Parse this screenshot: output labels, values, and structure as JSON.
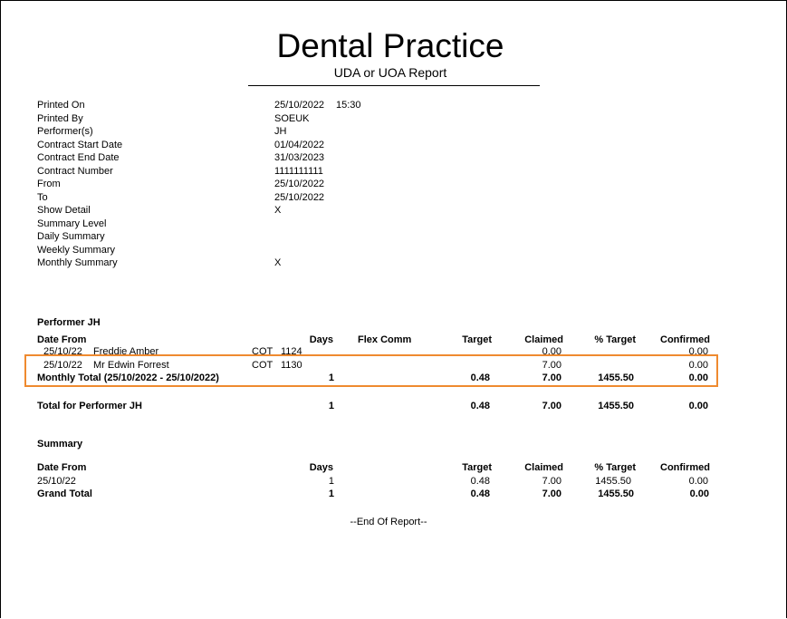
{
  "report": {
    "title": "Dental Practice",
    "subtitle": "UDA or UOA Report"
  },
  "info": [
    {
      "label": "Printed On",
      "value": "25/10/2022",
      "extra": "15:30"
    },
    {
      "label": "Printed By",
      "value": "SOEUK"
    },
    {
      "label": "Performer(s)",
      "value": "JH"
    },
    {
      "label": "Contract Start Date",
      "value": "01/04/2022"
    },
    {
      "label": "Contract End Date",
      "value": "31/03/2023"
    },
    {
      "label": "Contract Number",
      "value": "1111111111"
    },
    {
      "label": "From",
      "value": "25/10/2022"
    },
    {
      "label": "To",
      "value": "25/10/2022"
    },
    {
      "label": "Show Detail",
      "value": "X"
    },
    {
      "label": "Summary Level",
      "value": ""
    },
    {
      "label": "Daily Summary",
      "value": ""
    },
    {
      "label": "Weekly Summary",
      "value": ""
    },
    {
      "label": "Monthly Summary",
      "value": "X"
    }
  ],
  "performer": {
    "heading": "Performer JH",
    "columns": {
      "date_from": "Date From",
      "days": "Days",
      "flex_comm": "Flex Comm",
      "target": "Target",
      "claimed": "Claimed",
      "pct_target": "% Target",
      "confirmed": "Confirmed"
    },
    "rows": [
      {
        "date": "25/10/22",
        "name": "Freddie Amber",
        "code": "COT",
        "num": "1124",
        "claimed": "0.00",
        "confirmed": "0.00"
      },
      {
        "date": "25/10/22",
        "name": "Mr Edwin Forrest",
        "code": "COT",
        "num": "1130",
        "claimed": "7.00",
        "confirmed": "0.00"
      }
    ],
    "monthly_total": {
      "label": "Monthly Total (25/10/2022 - 25/10/2022)",
      "days": "1",
      "target": "0.48",
      "claimed": "7.00",
      "pct_target": "1455.50",
      "confirmed": "0.00"
    },
    "total": {
      "label": "Total for Performer JH",
      "days": "1",
      "target": "0.48",
      "claimed": "7.00",
      "pct_target": "1455.50",
      "confirmed": "0.00"
    }
  },
  "summary": {
    "heading": "Summary",
    "columns": {
      "date_from": "Date From",
      "days": "Days",
      "target": "Target",
      "claimed": "Claimed",
      "pct_target": "% Target",
      "confirmed": "Confirmed"
    },
    "row": {
      "date": "25/10/22",
      "days": "1",
      "target": "0.48",
      "claimed": "7.00",
      "pct_target": "1455.50",
      "confirmed": "0.00"
    },
    "grand_total": {
      "label": "Grand Total",
      "days": "1",
      "target": "0.48",
      "claimed": "7.00",
      "pct_target": "1455.50",
      "confirmed": "0.00"
    }
  },
  "footer": {
    "end_text": "--End Of Report--"
  },
  "colors": {
    "highlight": "#ef8a2f"
  }
}
